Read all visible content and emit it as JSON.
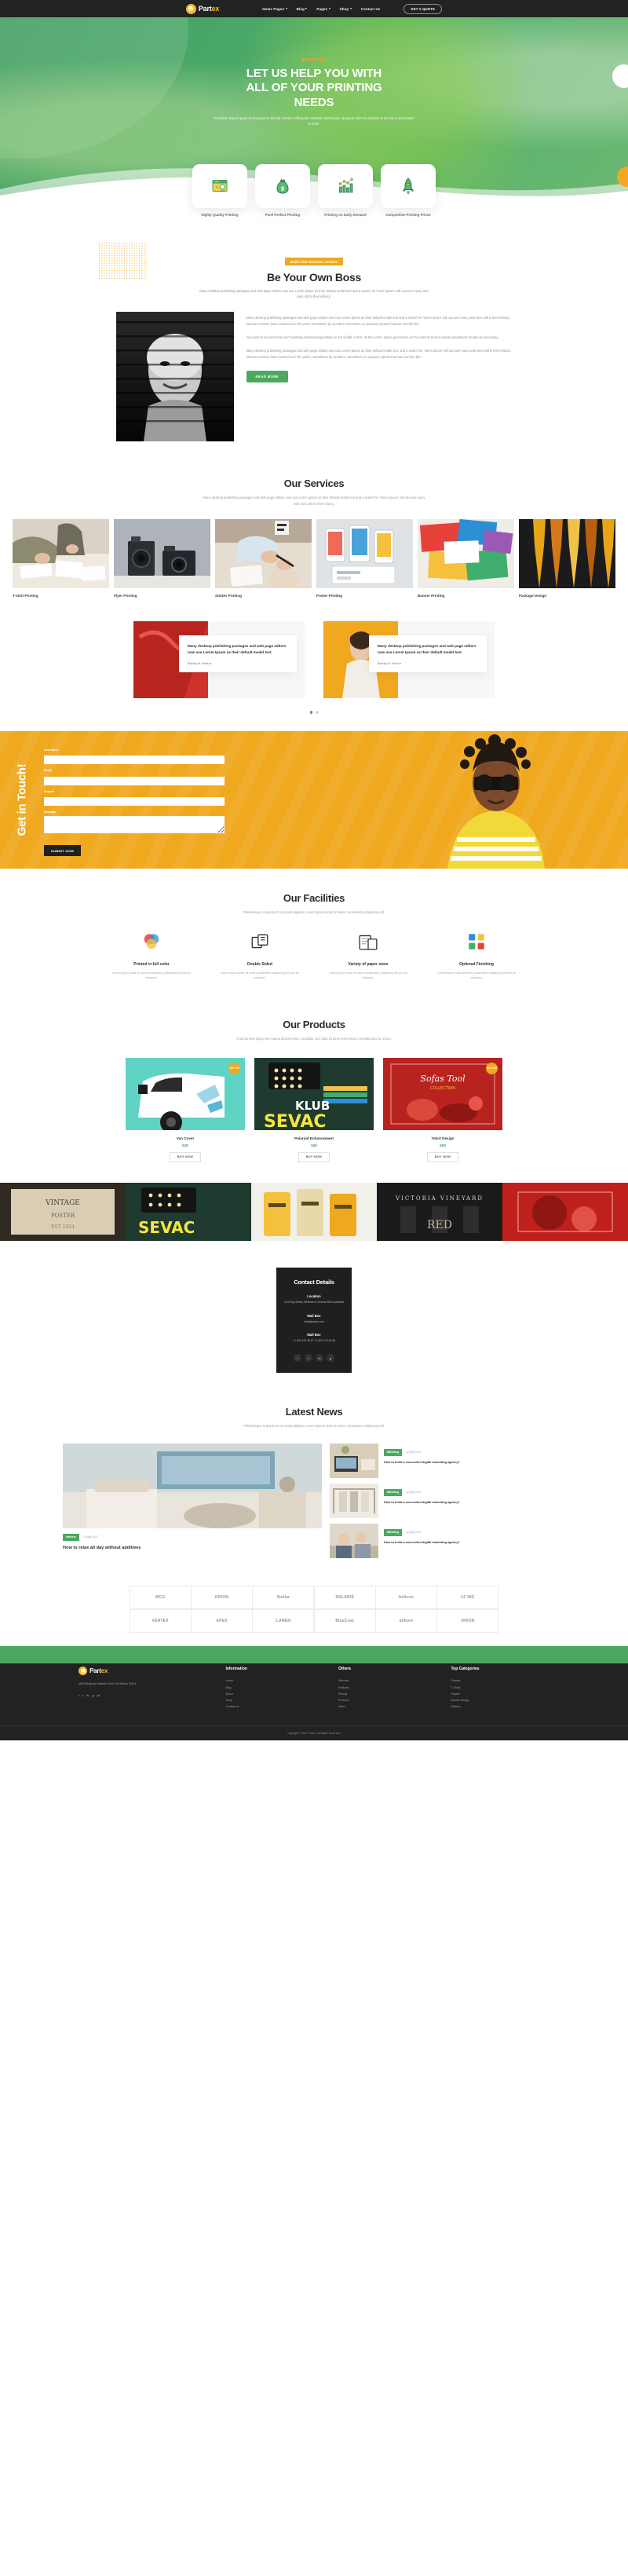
{
  "header": {
    "brand": {
      "name_dark": "Part",
      "name_accent": "ex",
      "icon": "printer-icon"
    },
    "nav": [
      {
        "label": "Home Pages",
        "caret": true
      },
      {
        "label": "Blog",
        "caret": true
      },
      {
        "label": "Pages",
        "caret": true
      },
      {
        "label": "Shop",
        "caret": true
      },
      {
        "label": "Contact Us",
        "caret": false
      }
    ],
    "cta": "GET A QUOTE"
  },
  "hero": {
    "eyebrow": "ABOUT US",
    "title_line1": "LET US HELP YOU WITH",
    "title_line2": "ALL OF YOUR PRINTING",
    "title_line3": "NEEDS",
    "subtitle": "Curabitur aliquet quam id dui posuere blandit. Donec sollicitudin molestie malesuada. Quisque velit nisi pretium ut lacinia in elementum id enim."
  },
  "features": [
    {
      "icon": "quality-badge-icon",
      "label": "Highly Quality Printing"
    },
    {
      "icon": "money-bag-icon",
      "label": "Pixel Perfect Printing"
    },
    {
      "icon": "chart-growth-icon",
      "label": "Printing on Daily Demand"
    },
    {
      "icon": "rocket-icon",
      "label": "Competitive Printing Prices"
    }
  ],
  "boss": {
    "badge": "Build Your Business Venture",
    "title": "Be Your Own Boss",
    "lead": "Many desktop publishing packages and web page editors now use Lorem Ipsum as their default model text and a search for 'lorem ipsum' will uncover many web sites still in their infancy.",
    "p1": "Many desktop publishing packages and web page editors now use Lorem Ipsum as their default model text and a search for 'lorem ipsum' will uncover many web sites still in their infancy. Various versions have evolved over the years sometimes by accident sometimes on purpose injected humour and the like.",
    "p2": "You need to be sure there isn't anything embarrassing hidden in the middle of text. All the Lorem Ipsum generators on the Internet tend to repeat predefined chunks as necessary.",
    "p3": "Many desktop publishing packages and web page editors now use Lorem Ipsum as their default model text, and a search for 'lorem ipsum' will uncover many web sites still in their infancy. Various versions have evolved over the years, sometimes by accident, sometimes on purpose injected humour and the like.",
    "button": "READ MORE"
  },
  "services": {
    "title": "Our Services",
    "lead": "Many desktop publishing packages and web page editors now use Lorem Ipsum as their default model text and a search for 'lorem ipsum' will uncover many web sites still in their infancy.",
    "items": [
      {
        "name": "T-shirt Printing",
        "image": "magazine-desk-photo"
      },
      {
        "name": "Flyer Printing",
        "image": "vintage-cameras-photo"
      },
      {
        "name": "Sticker Printing",
        "image": "designer-hands-photo"
      },
      {
        "name": "Poster Printing",
        "image": "mobile-mockups-photo"
      },
      {
        "name": "Banner Printing",
        "image": "colorful-papers-photo"
      },
      {
        "name": "Package Design",
        "image": "neckties-photo"
      }
    ]
  },
  "testimonials": [
    {
      "quote": "Many desktop publishing packages and web page editors now use Lorem Ipsum as their default model text.",
      "author": "Bobby R. Parker",
      "bg": "red-abstract-photo"
    },
    {
      "quote": "Many desktop publishing packages and web page editors now use Lorem Ipsum as their default model text.",
      "author": "Bobby R. Parker",
      "bg": "yellow-portrait-photo"
    }
  ],
  "contact_banner": {
    "vertical_title": "Get in Touch!",
    "fields": [
      {
        "label": "Your Name",
        "placeholder": "",
        "value": "",
        "type": "text"
      },
      {
        "label": "Email",
        "placeholder": "",
        "value": "",
        "type": "email"
      },
      {
        "label": "Subject",
        "placeholder": "",
        "value": "",
        "type": "text"
      },
      {
        "label": "Message",
        "placeholder": "",
        "value": "",
        "type": "textarea"
      }
    ],
    "submit": "SUBMIT NOW"
  },
  "facilities": {
    "title": "Our Facilities",
    "lead": "Pellentesque in ipsum id orci porta dapibus. Lorem ipsum dolor sit amet, consectetur adipiscing elit.",
    "items": [
      {
        "icon": "color-circles-icon",
        "name": "Printed in full color",
        "desc": "Lorem ipsum dolor sit amet consectetur adipiscing elit sed do eiusmod."
      },
      {
        "icon": "double-sided-icon",
        "name": "Double Sided",
        "desc": "Lorem ipsum dolor sit amet consectetur adipiscing elit sed do eiusmod."
      },
      {
        "icon": "paper-sizes-icon",
        "name": "Variety of paper sizes",
        "desc": "Lorem ipsum dolor sit amet consectetur adipiscing elit sed do eiusmod."
      },
      {
        "icon": "grid-squares-icon",
        "name": "Optional Finishing",
        "desc": "Lorem ipsum dolor sit amet consectetur adipiscing elit sed do eiusmod."
      }
    ]
  },
  "products": {
    "title": "Our Products",
    "lead": "Cras ultricies ligula sed magna dictum porta. Curabitur non nulla sit amet nisl tempus convallis quis ac lectus.",
    "items": [
      {
        "name": "Van Cover",
        "price": "$38",
        "badge": "25% Off",
        "image": "van-wrap-photo",
        "buy": "BUY NOW"
      },
      {
        "name": "Polaroid Enhancement",
        "price": "$58",
        "badge": "",
        "image": "klub-sevac-photo",
        "buy": "BUY NOW"
      },
      {
        "name": "Tshirt Design",
        "price": "$58",
        "badge": "25% Off",
        "image": "sofas-red-photo",
        "buy": "BUY NOW"
      }
    ]
  },
  "gallery_strip": [
    "vintage-poster-photo",
    "klub-sevac-photo",
    "yellow-packaging-photo",
    "victoria-vineyard-photo",
    "red-label-photo"
  ],
  "contact_details": {
    "title": "Contact Details",
    "blocks": [
      {
        "heading": "Location",
        "text": "123 King Street, Melbourne Victoria 3000 Australia"
      },
      {
        "heading": "Mail Box",
        "text": "info@partex.com"
      },
      {
        "heading": "Mail Box",
        "text": "+1 800 123 45 67 +1 800 123 45 68"
      }
    ],
    "social": [
      "f",
      "t",
      "in",
      "g"
    ]
  },
  "news": {
    "title": "Latest News",
    "lead": "Pellentesque in ipsum id orci porta dapibus. Lorem ipsum dolor sit amet, consectetur adipiscing elit.",
    "main": {
      "chip": "Interiors",
      "date": "12 May 2021",
      "title": "How to relax all day without additives",
      "image": "bedroom-interior-photo"
    },
    "side": [
      {
        "chip": "Marketing",
        "date": "12 May 2021",
        "title": "How to build a successful digital marketing agency?",
        "image": "laptop-desk-photo"
      },
      {
        "chip": "Marketing",
        "date": "12 May 2021",
        "title": "How to build a successful digital marketing agency?",
        "image": "fashion-rack-photo"
      },
      {
        "chip": "Marketing",
        "date": "12 May 2021",
        "title": "How to build a successful digital marketing agency?",
        "image": "office-team-photo"
      }
    ]
  },
  "clients": [
    [
      "MCG",
      "ORION",
      "Stellar",
      "SOLARIS",
      "helicon",
      "LF INC"
    ],
    [
      "VERTEX",
      "APEX",
      "LUMEN",
      "BlueCoat",
      "atikore",
      "ORION"
    ]
  ],
  "footer": {
    "brand": {
      "name_dark": "Part",
      "name_accent": "ex"
    },
    "address": "4825 Regional Software Suite 190 Atlanta 30194",
    "social": [
      "f",
      "t",
      "in",
      "g",
      "yt"
    ],
    "columns": [
      {
        "heading": "Information",
        "links": [
          "Home",
          "Blog",
          "About",
          "Shop",
          "Contact Us"
        ]
      },
      {
        "heading": "Others",
        "links": [
          "Services",
          "Features",
          "Pricing",
          "Products",
          "Team"
        ]
      },
      {
        "heading": "Top Categories",
        "links": [
          "Posters",
          "T-Shirts",
          "Papers",
          "Banner Design",
          "Stickers"
        ]
      }
    ],
    "copyright": "Copyright © 2021 Partex. All Rights Reserved."
  }
}
